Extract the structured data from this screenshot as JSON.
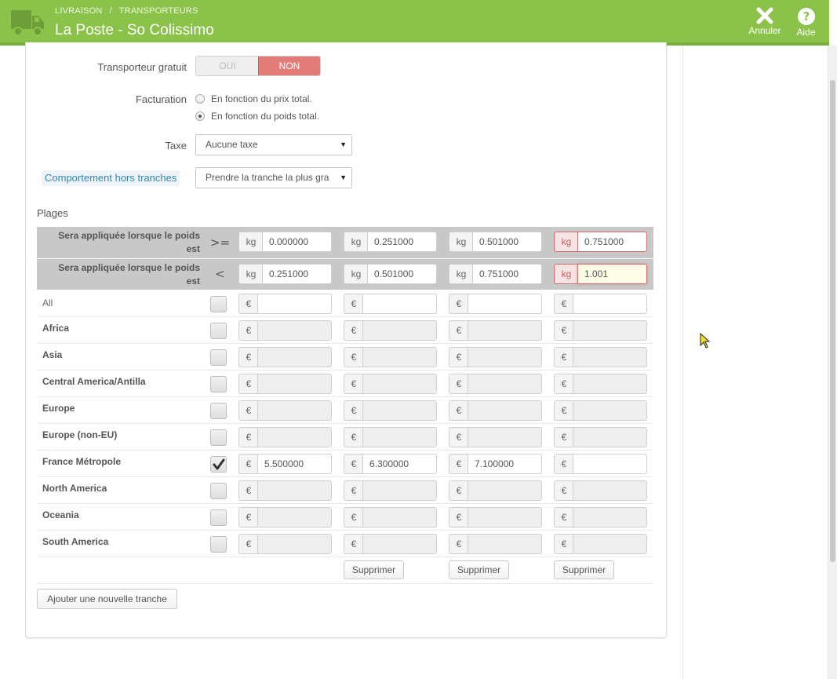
{
  "header": {
    "breadcrumb": [
      "LIVRAISON",
      "TRANSPORTEURS"
    ],
    "title": "La Poste - So Colissimo",
    "cancel_label": "Annuler",
    "help_label": "Aide"
  },
  "form": {
    "free_shipping": {
      "label": "Transporteur gratuit",
      "yes": "OUI",
      "no": "NON",
      "selected": "NON"
    },
    "billing": {
      "label": "Facturation",
      "options": [
        "En fonction du prix total.",
        "En fonction du poids total."
      ],
      "selected_index": 1
    },
    "tax": {
      "label": "Taxe",
      "value": "Aucune taxe"
    },
    "out_of_range": {
      "label": "Comportement hors tranches",
      "value": "Prendre la tranche la plus grande"
    }
  },
  "ranges": {
    "title": "Plages",
    "weight_unit": "kg",
    "currency": "€",
    "from_row": {
      "label": "Sera appliquée lorsque le poids est",
      "symbol": ">=",
      "values": [
        "0.000000",
        "0.251000",
        "0.501000",
        "0.751000"
      ]
    },
    "to_row": {
      "label": "Sera appliquée lorsque le poids est",
      "symbol": "<",
      "values": [
        "0.251000",
        "0.501000",
        "0.751000",
        "1.001"
      ]
    },
    "zones": [
      {
        "name": "All",
        "checked": false,
        "prices": [
          "",
          "",
          "",
          ""
        ]
      },
      {
        "name": "Africa",
        "checked": false,
        "prices": [
          "",
          "",
          "",
          ""
        ]
      },
      {
        "name": "Asia",
        "checked": false,
        "prices": [
          "",
          "",
          "",
          ""
        ]
      },
      {
        "name": "Central America/Antilla",
        "checked": false,
        "prices": [
          "",
          "",
          "",
          ""
        ]
      },
      {
        "name": "Europe",
        "checked": false,
        "prices": [
          "",
          "",
          "",
          ""
        ]
      },
      {
        "name": "Europe (non-EU)",
        "checked": false,
        "prices": [
          "",
          "",
          "",
          ""
        ]
      },
      {
        "name": "France Métropole",
        "checked": true,
        "prices": [
          "5.500000",
          "6.300000",
          "7.100000",
          ""
        ]
      },
      {
        "name": "North America",
        "checked": false,
        "prices": [
          "",
          "",
          "",
          ""
        ]
      },
      {
        "name": "Oceania",
        "checked": false,
        "prices": [
          "",
          "",
          "",
          ""
        ]
      },
      {
        "name": "South America",
        "checked": false,
        "prices": [
          "",
          "",
          "",
          ""
        ]
      }
    ],
    "delete_label": "Supprimer",
    "add_range_label": "Ajouter une nouvelle tranche"
  },
  "colors": {
    "header_green": "#8bc34a",
    "toggle_red": "#e27c79",
    "error_red": "#d36d6d",
    "hint_blue": "#3586ae"
  }
}
